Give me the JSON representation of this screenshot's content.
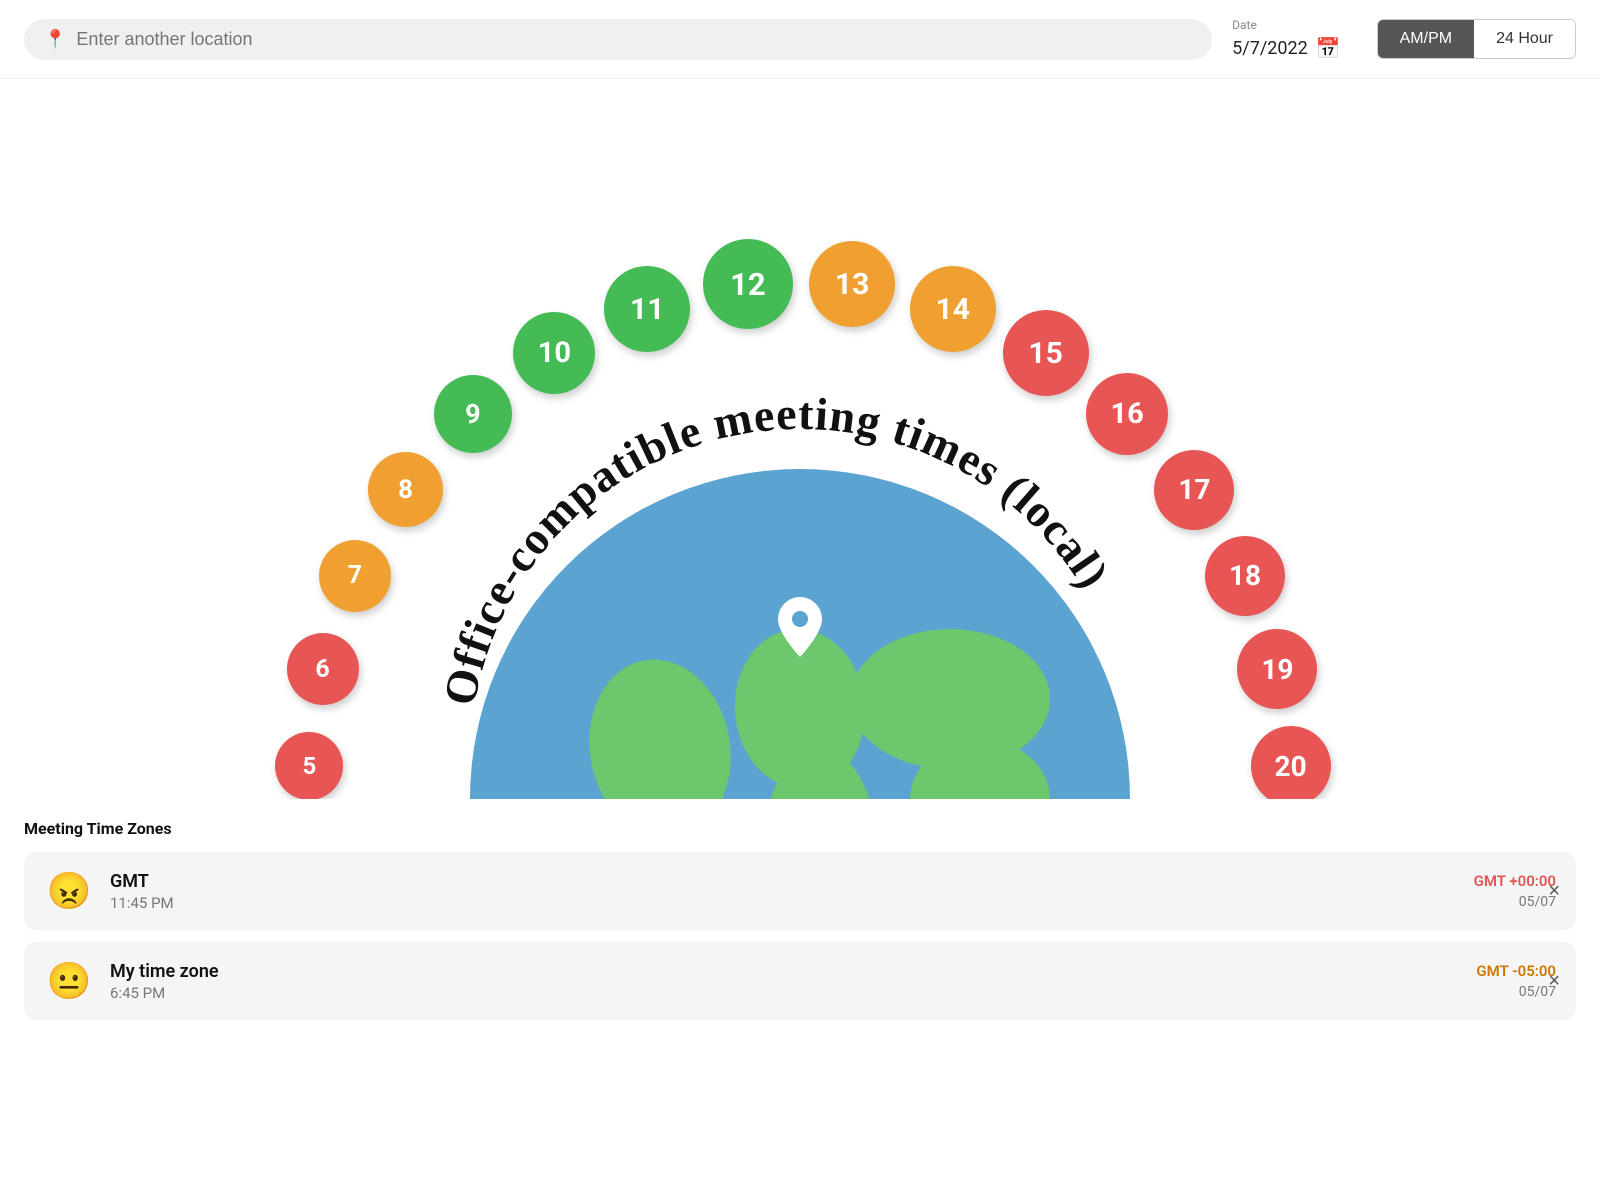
{
  "header": {
    "location_placeholder": "Enter another location",
    "date_label": "Date",
    "date_value": "5/7/2022",
    "ampm_label": "AM/PM",
    "hour24_label": "24 Hour",
    "active_format": "AM/PM"
  },
  "visualization": {
    "title": "Office-compatible meeting times (local)",
    "hours": [
      {
        "hour": 5,
        "color": "#e85555",
        "size": 68
      },
      {
        "hour": 6,
        "color": "#e85555",
        "size": 72
      },
      {
        "hour": 7,
        "color": "#f0a030",
        "size": 72
      },
      {
        "hour": 8,
        "color": "#f0a030",
        "size": 75
      },
      {
        "hour": 9,
        "color": "#44bb55",
        "size": 78
      },
      {
        "hour": 10,
        "color": "#44bb55",
        "size": 82
      },
      {
        "hour": 11,
        "color": "#44bb55",
        "size": 86
      },
      {
        "hour": 12,
        "color": "#44bb55",
        "size": 90
      },
      {
        "hour": 13,
        "color": "#f0a030",
        "size": 86
      },
      {
        "hour": 14,
        "color": "#f0a030",
        "size": 86
      },
      {
        "hour": 15,
        "color": "#e85555",
        "size": 86
      },
      {
        "hour": 16,
        "color": "#e85555",
        "size": 82
      },
      {
        "hour": 17,
        "color": "#e85555",
        "size": 80
      },
      {
        "hour": 18,
        "color": "#e85555",
        "size": 80
      },
      {
        "hour": 19,
        "color": "#e85555",
        "size": 80
      },
      {
        "hour": 20,
        "color": "#e85555",
        "size": 80
      }
    ]
  },
  "timezones": {
    "section_title": "Meeting Time Zones",
    "items": [
      {
        "emoji": "😠",
        "name": "GMT",
        "time": "11:45 PM",
        "offset": "GMT +00:00",
        "offset_color": "#e05555",
        "date": "05/07"
      },
      {
        "emoji": "😐",
        "name": "My time zone",
        "time": "6:45 PM",
        "offset": "GMT -05:00",
        "offset_color": "#cc7700",
        "date": "05/07"
      }
    ]
  }
}
